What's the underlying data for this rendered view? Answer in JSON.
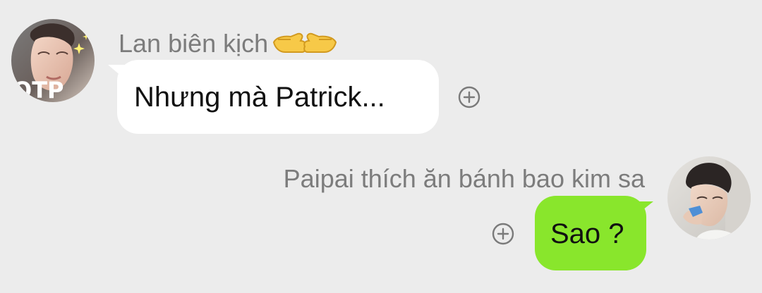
{
  "chat": {
    "messages": [
      {
        "sender": "Lan biên kịch",
        "sender_emoji": "backhand-index-pointing-left-and-right",
        "text": "Nhưng mà Patrick...",
        "avatar_overlay_text": "OTP",
        "direction": "incoming"
      },
      {
        "sender": "Paipai thích ăn bánh bao kim sa",
        "text": "Sao ?",
        "direction": "outgoing"
      }
    ]
  },
  "icons": {
    "react": "plus-circle-icon"
  },
  "colors": {
    "background": "#ececec",
    "incoming_bubble": "#ffffff",
    "outgoing_bubble": "#89e62c",
    "sender_name": "#7c7c7c",
    "message_text": "#111111",
    "icon": "#7a7a7a"
  }
}
